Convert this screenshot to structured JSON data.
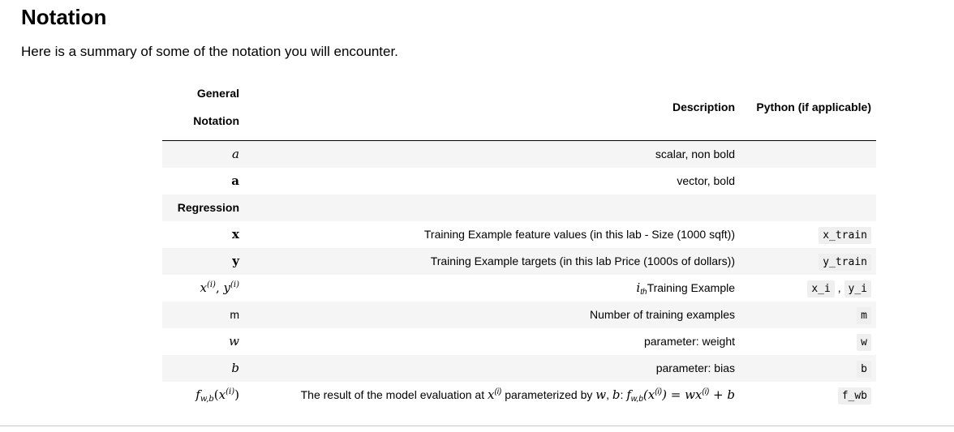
{
  "title": "Notation",
  "intro": "Here is a summary of some of the notation you will encounter.",
  "table": {
    "headers": {
      "general_line1": "General",
      "general_line2": "Notation",
      "description": "Description",
      "python": "Python (if applicable)"
    },
    "rows": {
      "a_scalar": {
        "symbol": "a",
        "description": "scalar, non bold",
        "python": ""
      },
      "a_vector": {
        "symbol": "a",
        "description": "vector, bold",
        "python": ""
      },
      "regression": {
        "label": "Regression"
      },
      "x_train": {
        "symbol": "x",
        "description": "Training Example feature values (in this lab - Size (1000 sqft))",
        "python": "x_train"
      },
      "y_train": {
        "symbol": "y",
        "description": "Training Example targets (in this lab Price (1000s of dollars))",
        "python": "y_train"
      },
      "xi_yi": {
        "sym_x": "x",
        "sym_sep": ", ",
        "sym_y": "y",
        "sup_i": "(i)",
        "desc_i": "i",
        "desc_th": "th",
        "desc_rest": "Training Example",
        "python_x": "x_i",
        "python_sep": ",",
        "python_y": "y_i"
      },
      "m": {
        "symbol": "m",
        "description": "Number of training examples",
        "python": "m"
      },
      "w": {
        "symbol": "w",
        "description": "parameter: weight",
        "python": "w"
      },
      "b": {
        "symbol": "b",
        "description": "parameter: bias",
        "python": "b"
      },
      "f_wb": {
        "f": "f",
        "sub_wb": "w,b",
        "open": "(",
        "x": "x",
        "sup_i": "(i)",
        "close": ")",
        "desc_part1": "The result of the model evaluation at ",
        "desc_part2": " parameterized by ",
        "desc_w": "w",
        "desc_comma": ", ",
        "desc_b": "b",
        "desc_colon": ": ",
        "desc_equals": " = ",
        "desc_wx": "wx",
        "desc_plus": " + ",
        "python": "f_wb"
      }
    }
  }
}
